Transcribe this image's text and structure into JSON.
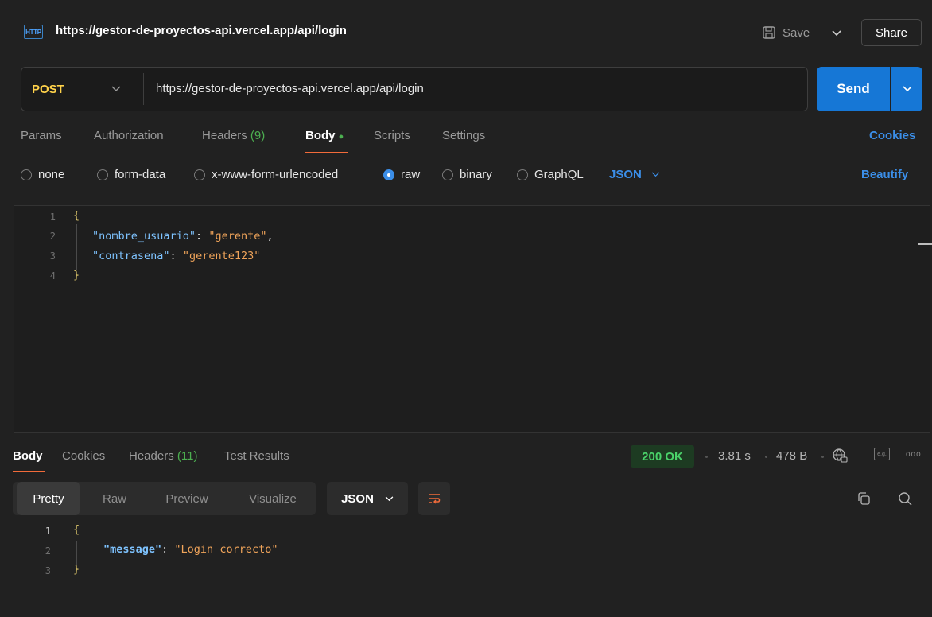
{
  "window": {
    "title": "https://gestor-de-proyectos-api.vercel.app/api/login",
    "http_badge": "HTTP",
    "save_label": "Save",
    "share_label": "Share"
  },
  "request": {
    "method": "POST",
    "url": "https://gestor-de-proyectos-api.vercel.app/api/login",
    "send_label": "Send"
  },
  "request_tabs": {
    "params": "Params",
    "authorization": "Authorization",
    "headers": "Headers",
    "headers_count": "(9)",
    "body": "Body",
    "scripts": "Scripts",
    "settings": "Settings",
    "cookies": "Cookies",
    "active": "Body"
  },
  "body_types": {
    "none": "none",
    "form_data": "form-data",
    "urlencoded": "x-www-form-urlencoded",
    "raw": "raw",
    "binary": "binary",
    "graphql": "GraphQL",
    "selected": "raw",
    "language": "JSON",
    "beautify": "Beautify"
  },
  "request_body": {
    "line_numbers": [
      "1",
      "2",
      "3",
      "4"
    ],
    "open_brace": "{",
    "close_brace": "}",
    "lines": [
      {
        "key": "\"nombre_usuario\"",
        "value": "\"gerente\"",
        "trail": ","
      },
      {
        "key": "\"contrasena\"",
        "value": "\"gerente123\"",
        "trail": ""
      }
    ]
  },
  "response_tabs": {
    "body": "Body",
    "cookies": "Cookies",
    "headers": "Headers",
    "headers_count": "(11)",
    "test_results": "Test Results",
    "active": "Body"
  },
  "response_meta": {
    "status": "200 OK",
    "time": "3.81 s",
    "size": "478 B",
    "status_color": "#4ad26a"
  },
  "response_view": {
    "pretty": "Pretty",
    "raw": "Raw",
    "preview": "Preview",
    "visualize": "Visualize",
    "active": "Pretty",
    "format": "JSON"
  },
  "response_body": {
    "line_numbers": [
      "1",
      "2",
      "3"
    ],
    "open_brace": "{",
    "close_brace": "}",
    "key": "\"message\"",
    "value": "\"Login correcto\""
  },
  "colors": {
    "accent": "#f26b3a",
    "primary_blue": "#1677d6",
    "method_post": "#ffd24a"
  },
  "icons": [
    "http-icon",
    "save-icon",
    "chevron-down-icon",
    "globe-icon",
    "example-icon",
    "more-icon",
    "wrap-icon",
    "copy-icon",
    "search-icon"
  ]
}
